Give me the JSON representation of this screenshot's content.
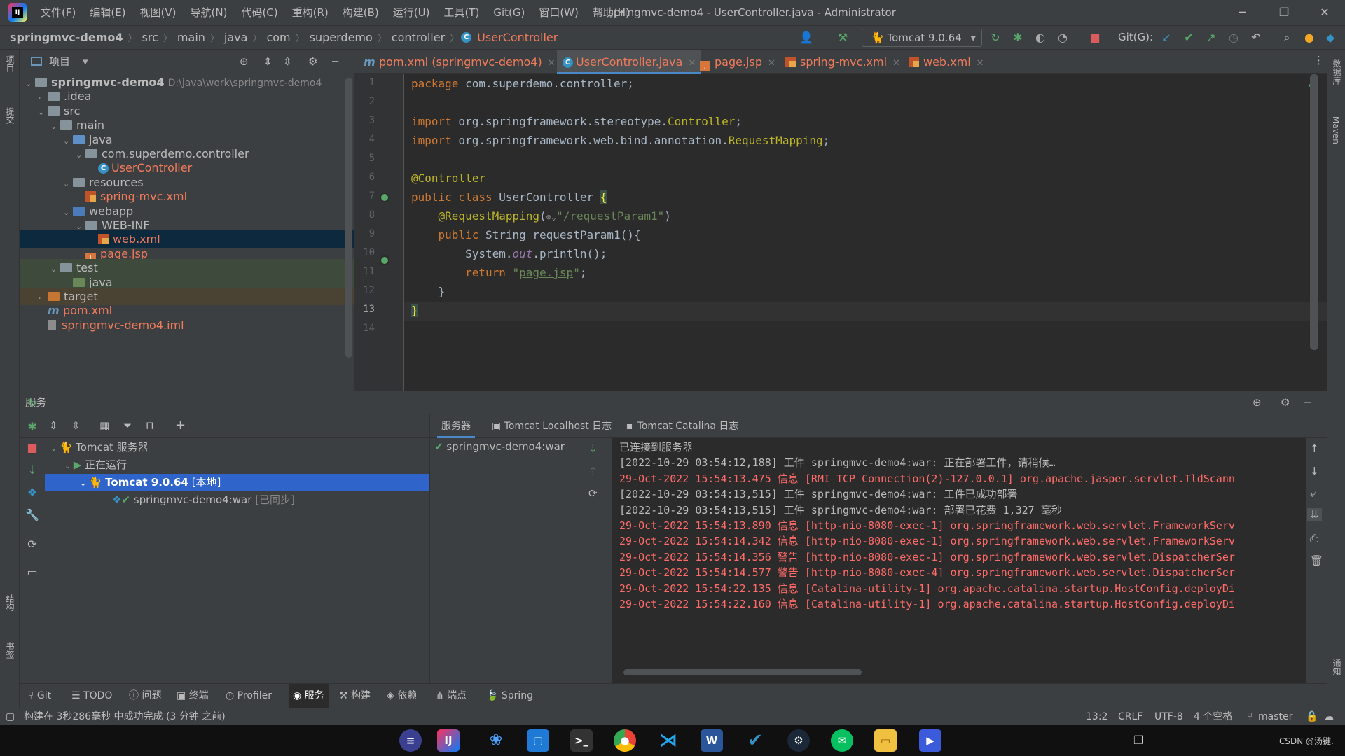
{
  "menubar": {
    "items": [
      "文件(F)",
      "编辑(E)",
      "视图(V)",
      "导航(N)",
      "代码(C)",
      "重构(R)",
      "构建(B)",
      "运行(U)",
      "工具(T)",
      "Git(G)",
      "窗口(W)",
      "帮助(H)"
    ],
    "window_title": "springmvc-demo4 - UserController.java - Administrator",
    "minimize": "─",
    "restore": "❐",
    "close": "✕"
  },
  "breadcrumb": {
    "items": [
      "springmvc-demo4",
      "src",
      "main",
      "java",
      "com",
      "superdemo",
      "controller"
    ],
    "current": "UserController",
    "sep": "〉"
  },
  "toolbar": {
    "run_config": "Tomcat 9.0.64",
    "git_label": "Git(G):"
  },
  "left_stripe": {
    "project": "项目",
    "commit": "提交",
    "structure": "结构",
    "bookmarks": "书签"
  },
  "right_stripe": {
    "database": "数据库",
    "maven": "Maven",
    "notifications": "通知"
  },
  "project": {
    "title": "项目",
    "tree": [
      {
        "label": "springmvc-demo4",
        "extra": "D:\\java\\work\\springmvc-demo4",
        "indent": 0,
        "arrow": "⌄",
        "icon": "folder",
        "bold": true
      },
      {
        "label": ".idea",
        "indent": 1,
        "arrow": "›",
        "icon": "folder"
      },
      {
        "label": "src",
        "indent": 1,
        "arrow": "⌄",
        "icon": "folder"
      },
      {
        "label": "main",
        "indent": 2,
        "arrow": "⌄",
        "icon": "folder"
      },
      {
        "label": "java",
        "indent": 3,
        "arrow": "⌄",
        "icon": "folder-src"
      },
      {
        "label": "com.superdemo.controller",
        "indent": 4,
        "arrow": "⌄",
        "icon": "package"
      },
      {
        "label": "UserController",
        "indent": 5,
        "arrow": "",
        "icon": "class",
        "color": "#f07b5b"
      },
      {
        "label": "resources",
        "indent": 3,
        "arrow": "⌄",
        "icon": "folder-res"
      },
      {
        "label": "spring-mvc.xml",
        "indent": 4,
        "arrow": "",
        "icon": "xml",
        "color": "#f07b5b"
      },
      {
        "label": "webapp",
        "indent": 3,
        "arrow": "⌄",
        "icon": "folder-web"
      },
      {
        "label": "WEB-INF",
        "indent": 4,
        "arrow": "⌄",
        "icon": "folder"
      },
      {
        "label": "web.xml",
        "indent": 5,
        "arrow": "",
        "icon": "xml",
        "color": "#f07b5b",
        "selected": true
      },
      {
        "label": "page.jsp",
        "indent": 4,
        "arrow": "",
        "icon": "jsp",
        "color": "#f07b5b"
      },
      {
        "label": "test",
        "indent": 2,
        "arrow": "⌄",
        "icon": "folder",
        "bg": "#3d4a3c"
      },
      {
        "label": "java",
        "indent": 3,
        "arrow": "",
        "icon": "folder-test",
        "bg": "#3d4a3c"
      },
      {
        "label": "target",
        "indent": 1,
        "arrow": "›",
        "icon": "folder-target",
        "bg": "#4a4233"
      },
      {
        "label": "pom.xml",
        "indent": 1,
        "arrow": "",
        "icon": "maven",
        "color": "#f07b5b"
      },
      {
        "label": "springmvc-demo4.iml",
        "indent": 1,
        "arrow": "",
        "icon": "iml",
        "color": "#f07b5b"
      }
    ]
  },
  "tabs": [
    {
      "label": "pom.xml (springmvc-demo4)",
      "icon": "maven",
      "color": "#f07b5b"
    },
    {
      "label": "UserController.java",
      "icon": "class",
      "color": "#f07b5b",
      "active": true
    },
    {
      "label": "page.jsp",
      "icon": "jsp",
      "color": "#f07b5b"
    },
    {
      "label": "spring-mvc.xml",
      "icon": "xml",
      "color": "#f07b5b"
    },
    {
      "label": "web.xml",
      "icon": "xml",
      "color": "#f07b5b"
    }
  ],
  "editor": {
    "line_numbers": [
      "1",
      "2",
      "3",
      "4",
      "5",
      "6",
      "7",
      "8",
      "9",
      "10",
      "11",
      "12",
      "13",
      "14"
    ],
    "l1_kw": "package",
    "l1_rest": " com.superdemo.controller;",
    "l3_kw": "import",
    "l3_pkg": " org.springframework.stereotype.",
    "l3_ann": "Controller",
    "l3_end": ";",
    "l4_kw": "import",
    "l4_pkg": " org.springframework.web.bind.annotation.",
    "l4_ann": "RequestMapping",
    "l4_end": ";",
    "l6": "@Controller",
    "l7_kw": "public class",
    "l7_name": " UserController ",
    "l7_brace": "{",
    "l8_ann": "@RequestMapping",
    "l8_open": "(",
    "l8_icon": "⊛⌄",
    "l8_q1": "\"",
    "l8_link": "/requestParam1",
    "l8_q2": "\"",
    "l8_close": ")",
    "l9_kw": "public",
    "l9_rest": " String requestParam1(){",
    "l10_a": "System.",
    "l10_out": "out",
    "l10_b": ".println();",
    "l11_kw": "return",
    "l11_q1": " \"",
    "l11_link": "page.jsp",
    "l11_q2": "\"",
    "l11_end": ";",
    "l12": "}",
    "l13": "}"
  },
  "services": {
    "title": "服务",
    "tree": {
      "root": "Tomcat 服务器",
      "running": "正在运行",
      "server": "Tomcat 9.0.64",
      "server_tag": "[本地]",
      "artifact": "springmvc-demo4:war",
      "artifact_tag": "[已同步]"
    },
    "tabs": [
      "服务器",
      "Tomcat Localhost 日志",
      "Tomcat Catalina 日志"
    ],
    "deployment": "springmvc-demo4:war",
    "console": [
      {
        "text": "已连接到服务器",
        "level": "white"
      },
      {
        "text": "[2022-10-29 03:54:12,188] 工件 springmvc-demo4:war: 正在部署工件，请稍候…",
        "level": "white"
      },
      {
        "text": "29-Oct-2022 15:54:13.475 信息 [RMI TCP Connection(2)-127.0.0.1] org.apache.jasper.servlet.TldScann",
        "level": "red"
      },
      {
        "text": "[2022-10-29 03:54:13,515] 工件 springmvc-demo4:war: 工件已成功部署",
        "level": "white"
      },
      {
        "text": "[2022-10-29 03:54:13,515] 工件 springmvc-demo4:war: 部署已花费 1,327 毫秒",
        "level": "white"
      },
      {
        "text": "29-Oct-2022 15:54:13.890 信息 [http-nio-8080-exec-1] org.springframework.web.servlet.FrameworkServ",
        "level": "red"
      },
      {
        "text": "29-Oct-2022 15:54:14.342 信息 [http-nio-8080-exec-1] org.springframework.web.servlet.FrameworkServ",
        "level": "red"
      },
      {
        "text": "29-Oct-2022 15:54:14.356 警告 [http-nio-8080-exec-1] org.springframework.web.servlet.DispatcherSer",
        "level": "red"
      },
      {
        "text": "29-Oct-2022 15:54:14.577 警告 [http-nio-8080-exec-4] org.springframework.web.servlet.DispatcherSer",
        "level": "red"
      },
      {
        "text": "29-Oct-2022 15:54:22.135 信息 [Catalina-utility-1] org.apache.catalina.startup.HostConfig.deployDi",
        "level": "red"
      },
      {
        "text": "29-Oct-2022 15:54:22.160 信息 [Catalina-utility-1] org.apache.catalina.startup.HostConfig.deployDi",
        "level": "red"
      }
    ]
  },
  "bottom_tools": [
    {
      "label": "Git",
      "icon": "git-icon"
    },
    {
      "label": "TODO",
      "icon": "todo-icon"
    },
    {
      "label": "问题",
      "icon": "problems-icon"
    },
    {
      "label": "终端",
      "icon": "terminal-icon"
    },
    {
      "label": "Profiler",
      "icon": "profiler-icon"
    },
    {
      "label": "服务",
      "icon": "services-icon",
      "active": true
    },
    {
      "label": "构建",
      "icon": "build-icon"
    },
    {
      "label": "依赖",
      "icon": "dependencies-icon"
    },
    {
      "label": "端点",
      "icon": "endpoints-icon"
    },
    {
      "label": "Spring",
      "icon": "spring-icon"
    }
  ],
  "status": {
    "message": "构建在 3秒286毫秒 中成功完成 (3 分钟 之前)",
    "position": "13:2",
    "line_sep": "CRLF",
    "encoding": "UTF-8",
    "indent": "4 个空格",
    "branch": "master"
  },
  "taskbar": {
    "watermark": "CSDN @汤键."
  }
}
